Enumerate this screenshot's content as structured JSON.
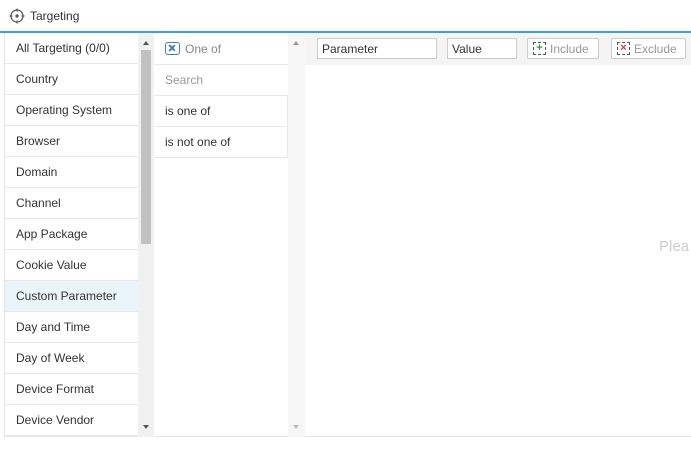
{
  "header": {
    "title": "Targeting",
    "icon": "crosshair-icon"
  },
  "categories": [
    {
      "label": "All Targeting (0/0)"
    },
    {
      "label": "Country"
    },
    {
      "label": "Operating System"
    },
    {
      "label": "Browser"
    },
    {
      "label": "Domain"
    },
    {
      "label": "Channel"
    },
    {
      "label": "App Package"
    },
    {
      "label": "Cookie Value"
    },
    {
      "label": "Custom Parameter",
      "selected": true
    },
    {
      "label": "Day and Time"
    },
    {
      "label": "Day of Week"
    },
    {
      "label": "Device Format"
    },
    {
      "label": "Device Vendor"
    }
  ],
  "operator": {
    "header_label": "One of",
    "search_placeholder": "Search",
    "options": [
      "is one of",
      "is not one of"
    ]
  },
  "editor": {
    "parameter_value": "Parameter",
    "value_value": "Value",
    "include_label": "Include",
    "exclude_label": "Exclude",
    "hint_text": "Plea"
  },
  "colors": {
    "accent": "#3aa0d8",
    "selected_row": "#eaf5fb",
    "include": "#2e9e3e",
    "exclude": "#d23b3b"
  }
}
